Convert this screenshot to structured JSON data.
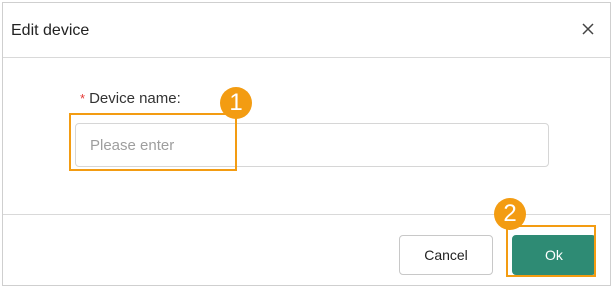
{
  "dialog": {
    "title": "Edit device",
    "close_icon": "close-icon",
    "field": {
      "required_mark": "*",
      "label": "Device name:",
      "value": "",
      "placeholder": "Please enter"
    },
    "cancel_label": "Cancel",
    "ok_label": "Ok"
  },
  "annotations": {
    "step1": "1",
    "step2": "2",
    "highlight_color": "#f39c12"
  },
  "colors": {
    "primary": "#2e8b74",
    "required": "#e53935"
  }
}
